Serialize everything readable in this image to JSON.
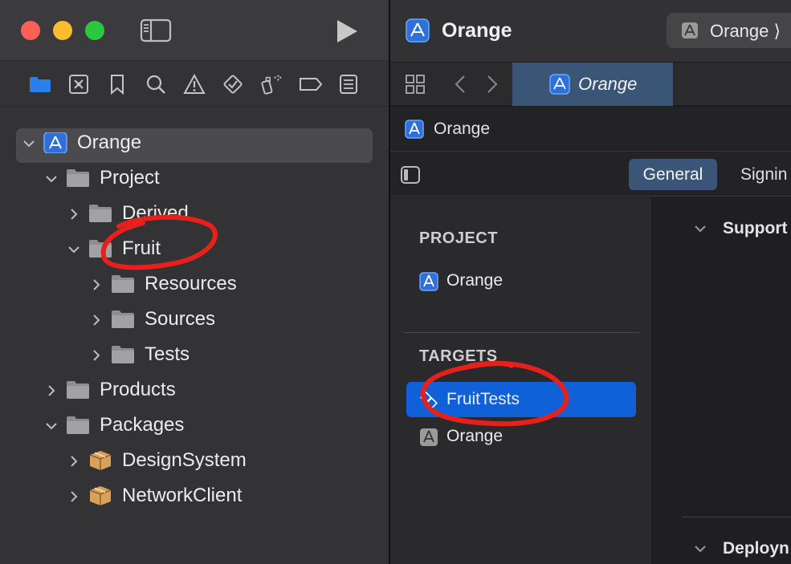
{
  "window": {
    "title": "Orange",
    "scheme": "Orange ⟩"
  },
  "navigator": {
    "tree": [
      {
        "label": "Orange",
        "level": 0,
        "icon": "app-icon",
        "expanded": true,
        "selected": true
      },
      {
        "label": "Project",
        "level": 1,
        "icon": "folder-icon",
        "expanded": true
      },
      {
        "label": "Derived",
        "level": 2,
        "icon": "folder-icon",
        "expanded": false
      },
      {
        "label": "Fruit",
        "level": 2,
        "icon": "folder-icon",
        "expanded": true
      },
      {
        "label": "Resources",
        "level": 3,
        "icon": "folder-icon",
        "expanded": false
      },
      {
        "label": "Sources",
        "level": 3,
        "icon": "folder-icon",
        "expanded": false
      },
      {
        "label": "Tests",
        "level": 3,
        "icon": "folder-icon",
        "expanded": false
      },
      {
        "label": "Products",
        "level": 1,
        "icon": "folder-icon",
        "expanded": false
      },
      {
        "label": "Packages",
        "level": 1,
        "icon": "folder-icon",
        "expanded": true
      },
      {
        "label": "DesignSystem",
        "level": 2,
        "icon": "package-icon",
        "expanded": false
      },
      {
        "label": "NetworkClient",
        "level": 2,
        "icon": "package-icon",
        "expanded": false
      }
    ]
  },
  "editor": {
    "tab_label": "Orange",
    "jump_label": "Orange",
    "segments": {
      "general": "General",
      "signing": "Signin"
    },
    "project_header": "PROJECT",
    "project_item": "Orange",
    "targets_header": "TARGETS",
    "targets": [
      {
        "label": "FruitTests",
        "selected": true,
        "icon": "test-target-icon"
      },
      {
        "label": "Orange",
        "selected": false,
        "icon": "app-target-icon"
      }
    ],
    "sections": [
      "Support",
      "Deployn"
    ]
  },
  "colors": {
    "accent": "#1060d8",
    "annotation": "#e8201c",
    "tab_active": "#3a5575"
  }
}
